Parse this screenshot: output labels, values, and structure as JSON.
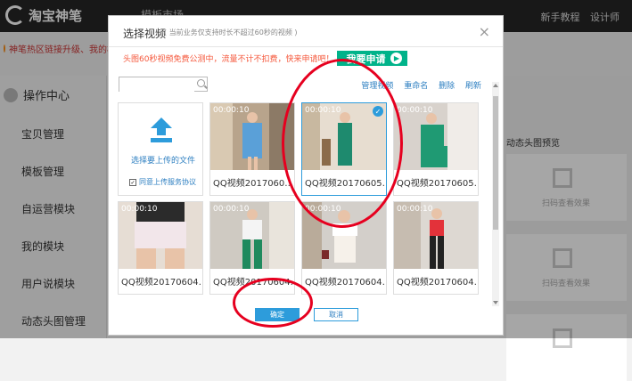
{
  "app": {
    "logo_text": "淘宝神笔",
    "top_tab": "模板市场",
    "top_links": [
      "新手教程",
      "设计师"
    ],
    "notice": "神笔热区链接升级、我的模块"
  },
  "sidebar": {
    "header": "操作中心",
    "items": [
      "宝贝管理",
      "模板管理",
      "自运营模块",
      "我的模块",
      "用户说模块",
      "动态头图管理"
    ]
  },
  "right_panel": {
    "preview_label": "动态头图预览",
    "qr_hint": "扫码查看效果"
  },
  "dialog": {
    "title": "选择视频",
    "subtitle": "( 当前业务仅支持时长不超过60秒的视频 )",
    "close": "×",
    "promo_text": "头图60秒视频免费公测中，流量不计不扣费，快来申请吧！",
    "apply_label": "我要申请",
    "search": {
      "value": "",
      "placeholder": ""
    },
    "actions": [
      "管理视频",
      "重命名",
      "删除",
      "刷新"
    ],
    "upload": {
      "label": "选择要上传的文件",
      "agreement": "同意上传服务协议",
      "checked": "✓"
    },
    "videos": [
      {
        "time": "00:00:10",
        "name": "QQ视频2017060…",
        "selected": false
      },
      {
        "time": "00:00:10",
        "name": "QQ视频20170605…",
        "selected": true
      },
      {
        "time": "00:00:10",
        "name": "QQ视频20170605…",
        "selected": false
      },
      {
        "time": "00:00:10",
        "name": "QQ视频20170604…",
        "selected": false
      },
      {
        "time": "00:00:10",
        "name": "QQ视频20170604…",
        "selected": false
      },
      {
        "time": "00:00:10",
        "name": "QQ视频20170604…",
        "selected": false
      },
      {
        "time": "00:00:10",
        "name": "QQ视频20170604…",
        "selected": false
      }
    ],
    "confirm_label": "确定",
    "cancel_label": "取消"
  },
  "colors": {
    "accent": "#2d9cdb",
    "promo_green": "#00b38a",
    "highlight_ring": "#e6001f"
  }
}
